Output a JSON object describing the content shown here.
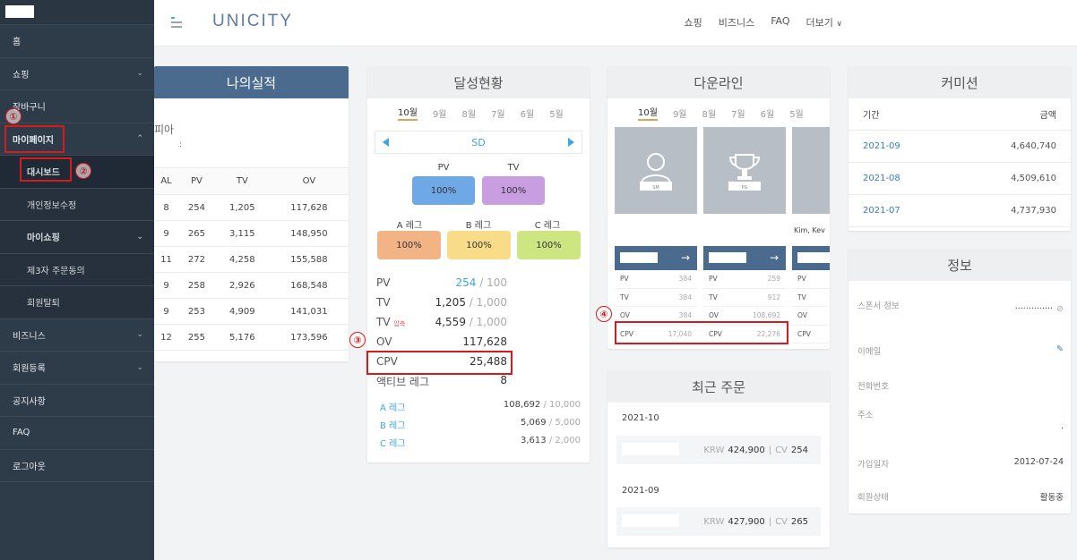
{
  "sidebar": {
    "items": [
      {
        "label": "홈"
      },
      {
        "label": "쇼핑"
      },
      {
        "label": "장바구니"
      },
      {
        "label": "마이페이지"
      },
      {
        "label": "대시보드"
      },
      {
        "label": "개인정보수정"
      },
      {
        "label": "마이쇼핑"
      },
      {
        "label": "제3자 주문동의"
      },
      {
        "label": "회원탈퇴"
      },
      {
        "label": "비즈니스"
      },
      {
        "label": "회원등록"
      },
      {
        "label": "공지사항"
      },
      {
        "label": "FAQ"
      },
      {
        "label": "로그아웃"
      }
    ]
  },
  "header": {
    "logo": "UNICITY",
    "nav": [
      "쇼핑",
      "비즈니스",
      "FAQ",
      "더보기"
    ]
  },
  "annotations": [
    "①",
    "②",
    "③",
    "④"
  ],
  "performance": {
    "title": "나의실적",
    "subtitle": "피아",
    "colon": ":",
    "columns": [
      "AL",
      "PV",
      "TV",
      "OV"
    ],
    "rows": [
      [
        "8",
        "254",
        "1,205",
        "117,628"
      ],
      [
        "9",
        "265",
        "3,115",
        "148,950"
      ],
      [
        "11",
        "272",
        "4,258",
        "155,588"
      ],
      [
        "9",
        "258",
        "2,926",
        "168,548"
      ],
      [
        "9",
        "253",
        "4,909",
        "141,031"
      ],
      [
        "12",
        "255",
        "5,176",
        "173,596"
      ]
    ]
  },
  "achievement": {
    "title": "달성현황",
    "months": [
      "10월",
      "9월",
      "8월",
      "7월",
      "6월",
      "5월"
    ],
    "rank": "SD",
    "pv_label": "PV",
    "tv_label": "TV",
    "pv_pct": "100%",
    "tv_pct": "100%",
    "a_label": "A 레그",
    "b_label": "B 레그",
    "c_label": "C 레그",
    "a_pct": "100%",
    "b_pct": "100%",
    "c_pct": "100%",
    "stats": [
      {
        "label": "PV",
        "value": "254",
        "target": "/ 100"
      },
      {
        "label": "TV",
        "value": "1,205",
        "target": "/ 1,000"
      },
      {
        "label": "TV",
        "tag": "압축",
        "value": "4,559",
        "target": "/ 1,000"
      },
      {
        "label": "OV",
        "value": "117,628",
        "target": ""
      },
      {
        "label": "CPV",
        "value": "25,488",
        "target": ""
      },
      {
        "label": "액티브 레그",
        "value": "8",
        "target": ""
      }
    ],
    "legs": [
      {
        "label": "A 레그",
        "value": "108,692",
        "target": "/ 10,000"
      },
      {
        "label": "B 레그",
        "value": "5,069",
        "target": "/ 5,000"
      },
      {
        "label": "C 레그",
        "value": "3,613",
        "target": "/ 2,000"
      }
    ]
  },
  "downline": {
    "title": "다운라인",
    "months": [
      "10월",
      "9월",
      "8월",
      "7월",
      "6월",
      "5월"
    ],
    "cards": [
      {
        "badge": "SM",
        "name": "",
        "pv": "384",
        "tv": "384",
        "ov": "384",
        "cpv": "17,040"
      },
      {
        "badge": "PG",
        "name": "",
        "pv": "259",
        "tv": "912",
        "ov": "108,692",
        "cpv": "22,276"
      },
      {
        "badge": "",
        "name": "Kim, Kev",
        "pv": "",
        "tv": "",
        "ov": "",
        "cpv": ""
      }
    ],
    "row_labels": [
      "PV",
      "TV",
      "OV",
      "CPV"
    ],
    "arrow": "→"
  },
  "commission": {
    "title": "커미션",
    "period_label": "기간",
    "amount_label": "금액",
    "rows": [
      {
        "period": "2021-09",
        "amount": "4,640,740"
      },
      {
        "period": "2021-08",
        "amount": "4,509,610"
      },
      {
        "period": "2021-07",
        "amount": "4,737,930"
      }
    ]
  },
  "info": {
    "title": "정보",
    "sponsor_label": "스폰서 정보",
    "sponsor_value": "··············",
    "email_label": "이메일",
    "phone_label": "전화번호",
    "address_label": "주소",
    "address_dot": ".",
    "join_label": "가입일자",
    "join_value": "2012-07-24",
    "status_label": "회원상태",
    "status_value": "활동중"
  },
  "orders": {
    "title": "최근 주문",
    "groups": [
      {
        "date": "2021-10",
        "currency": "KRW",
        "amount": "424,900",
        "sep": "|",
        "cv_label": "CV",
        "cv": "254"
      },
      {
        "date": "2021-09",
        "currency": "KRW",
        "amount": "427,900",
        "sep": "|",
        "cv_label": "CV",
        "cv": "265"
      }
    ]
  }
}
